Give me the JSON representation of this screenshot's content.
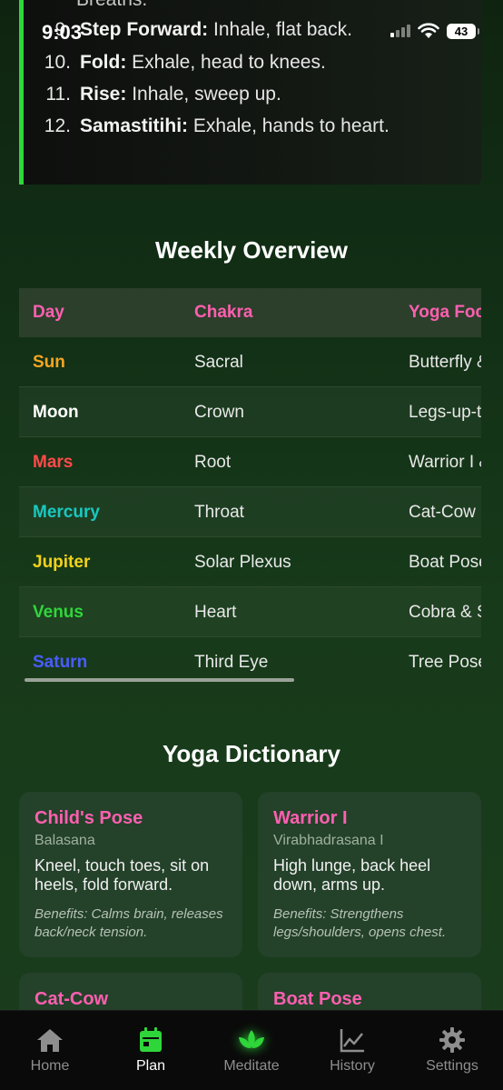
{
  "status_bar": {
    "time": "9:03",
    "battery": "43"
  },
  "steps": {
    "partial_text": "Breaths.",
    "items": [
      {
        "num": "9.",
        "term": "Step Forward:",
        "text": " Inhale, flat back."
      },
      {
        "num": "10.",
        "term": "Fold:",
        "text": " Exhale, head to knees."
      },
      {
        "num": "11.",
        "term": "Rise:",
        "text": " Inhale, sweep up."
      },
      {
        "num": "12.",
        "term": "Samastitihi:",
        "text": " Exhale, hands to heart."
      }
    ]
  },
  "weekly_overview": {
    "title": "Weekly Overview",
    "columns": [
      "Day",
      "Chakra",
      "Yoga Foc"
    ],
    "rows": [
      {
        "day": "Sun",
        "chakra": "Sacral",
        "focus": "Butterfly &",
        "color": "#f5a623"
      },
      {
        "day": "Moon",
        "chakra": "Crown",
        "focus": "Legs-up-t",
        "color": "#ffffff"
      },
      {
        "day": "Mars",
        "chakra": "Root",
        "focus": "Warrior I &",
        "color": "#ff4a4a"
      },
      {
        "day": "Mercury",
        "chakra": "Throat",
        "focus": "Cat-Cow",
        "color": "#19c8c0"
      },
      {
        "day": "Jupiter",
        "chakra": "Solar Plexus",
        "focus": "Boat Pose",
        "color": "#f2d21b"
      },
      {
        "day": "Venus",
        "chakra": "Heart",
        "focus": "Cobra & S",
        "color": "#2fd63a"
      },
      {
        "day": "Saturn",
        "chakra": "Third Eye",
        "focus": "Tree Pose",
        "color": "#4a5cff"
      }
    ]
  },
  "dictionary": {
    "title": "Yoga Dictionary",
    "cards": [
      {
        "name": "Child's Pose",
        "sanskrit": "Balasana",
        "desc": "Kneel, touch toes, sit on heels, fold forward.",
        "benefits": "Benefits: Calms brain, releases back/neck tension."
      },
      {
        "name": "Warrior I",
        "sanskrit": "Virabhadrasana I",
        "desc": "High lunge, back heel down, arms up.",
        "benefits": "Benefits: Strengthens legs/shoulders, opens chest."
      },
      {
        "name": "Cat-Cow",
        "sanskrit": "",
        "desc": "",
        "benefits": ""
      },
      {
        "name": "Boat Pose",
        "sanskrit": "",
        "desc": "",
        "benefits": ""
      }
    ]
  },
  "nav": {
    "items": [
      {
        "label": "Home",
        "icon": "home-icon"
      },
      {
        "label": "Plan",
        "icon": "calendar-icon"
      },
      {
        "label": "Meditate",
        "icon": "lotus-icon"
      },
      {
        "label": "History",
        "icon": "chart-icon"
      },
      {
        "label": "Settings",
        "icon": "gear-icon"
      }
    ],
    "active": "Plan",
    "accent_color": "#2fd63a"
  }
}
